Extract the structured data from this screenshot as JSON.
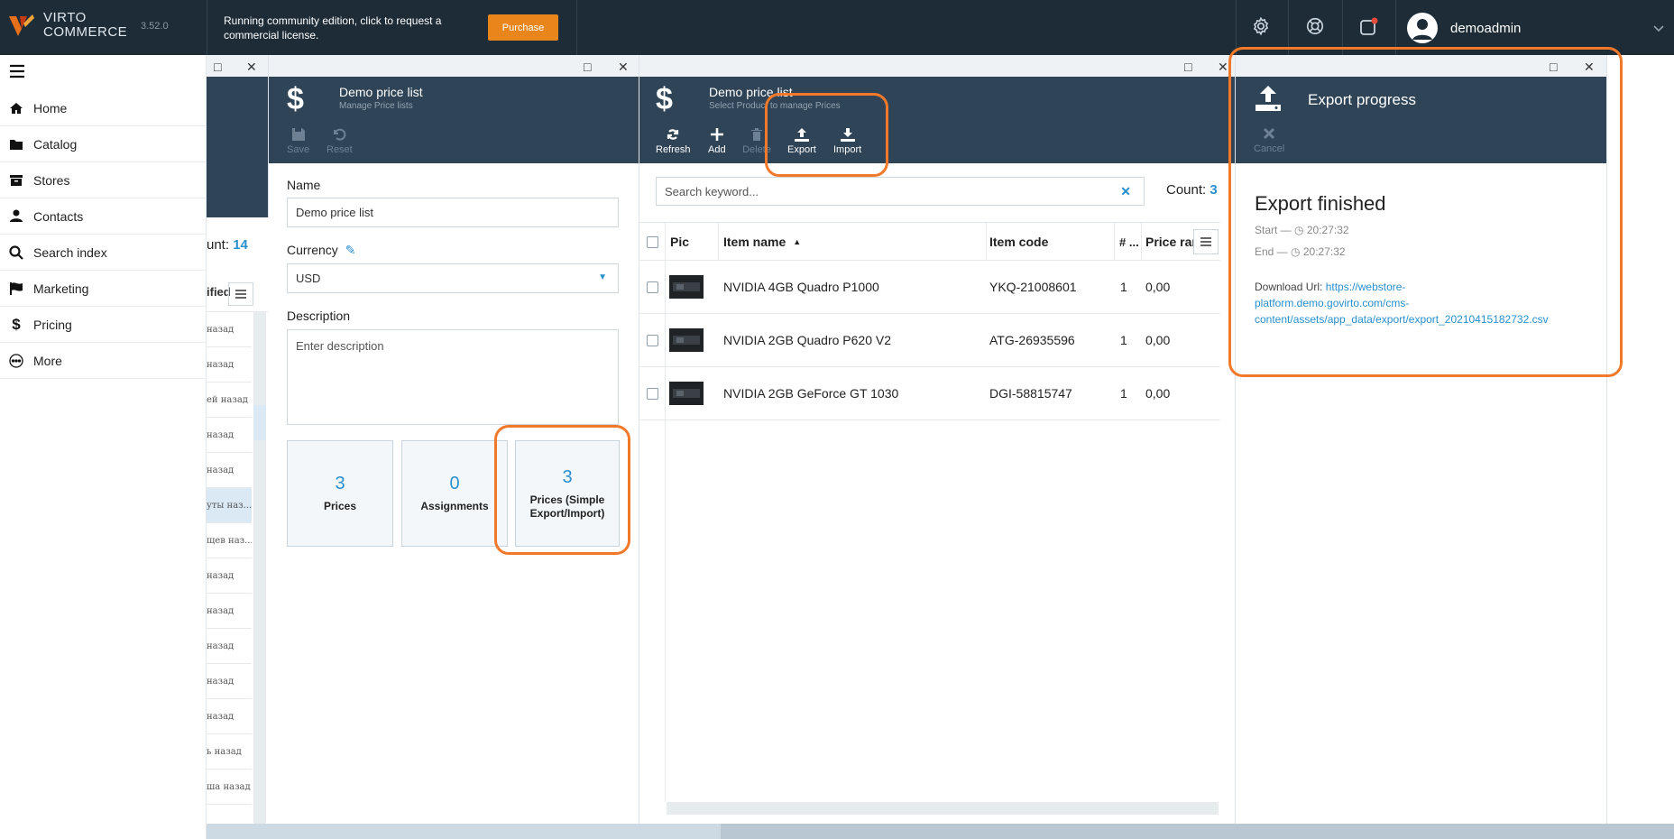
{
  "app": {
    "logo_line1": "VIRTO",
    "logo_line2": "COMMERCE",
    "version": "3.52.0",
    "notice": "Running community edition, click to request a commercial license.",
    "purchase_label": "Purchase",
    "username": "demoadmin"
  },
  "sidebar": {
    "items": [
      {
        "label": "Home",
        "icon": "home-icon"
      },
      {
        "label": "Catalog",
        "icon": "folder-icon"
      },
      {
        "label": "Stores",
        "icon": "archive-icon"
      },
      {
        "label": "Contacts",
        "icon": "user-icon"
      },
      {
        "label": "Search index",
        "icon": "search-icon"
      },
      {
        "label": "Marketing",
        "icon": "flag-icon"
      },
      {
        "label": "Pricing",
        "icon": "dollar-icon"
      },
      {
        "label": "More",
        "icon": "more-icon"
      }
    ]
  },
  "list_blade": {
    "count_label": "unt:",
    "count_value": "14",
    "column_header": "ified",
    "rows": [
      "назад",
      "назад",
      "ей назад",
      "назад",
      "назад",
      "уты наз...",
      "щев наз...",
      "назад",
      "назад",
      "назад",
      "назад",
      "назад",
      "ь назад",
      "ша назад"
    ]
  },
  "pricelist_blade": {
    "title": "Demo price list",
    "subtitle": "Manage Price lists",
    "toolbar": {
      "save": "Save",
      "reset": "Reset"
    },
    "name_label": "Name",
    "name_value": "Demo price list",
    "currency_label": "Currency",
    "currency_value": "USD",
    "description_label": "Description",
    "description_placeholder": "Enter description",
    "tiles": [
      {
        "num": "3",
        "label": "Prices"
      },
      {
        "num": "0",
        "label": "Assignments"
      },
      {
        "num": "3",
        "label": "Prices (Simple Export/Import)"
      }
    ]
  },
  "prices_blade": {
    "title": "Demo price list",
    "subtitle": "Select Product to manage Prices",
    "toolbar": {
      "refresh": "Refresh",
      "add": "Add",
      "delete": "Delete",
      "export": "Export",
      "import": "Import"
    },
    "search_placeholder": "Search keyword...",
    "count_label": "Count:",
    "count_value": "3",
    "columns": {
      "pic": "Pic",
      "name": "Item name",
      "code": "Item code",
      "qty": "# ...",
      "price": "Price ran"
    },
    "rows": [
      {
        "name": "NVIDIA 4GB Quadro P1000",
        "code": "YKQ-21008601",
        "qty": "1",
        "price": "0,00"
      },
      {
        "name": "NVIDIA 2GB Quadro P620 V2",
        "code": "ATG-26935596",
        "qty": "1",
        "price": "0,00"
      },
      {
        "name": "NVIDIA 2GB GeForce GT 1030",
        "code": "DGI-58815747",
        "qty": "1",
        "price": "0,00"
      }
    ]
  },
  "export_blade": {
    "title": "Export progress",
    "cancel": "Cancel",
    "heading": "Export finished",
    "start_label": "Start —",
    "start_time": "20:27:32",
    "end_label": "End —",
    "end_time": "20:27:32",
    "download_label": "Download Url:",
    "download_url_1": "https://webstore-",
    "download_url_2": "platform.demo.govirto.com/cms-",
    "download_url_3": "content/assets/app_data/export/export_20210415182732.csv"
  },
  "colors": {
    "header_bg": "#1e2c38",
    "blade_head_bg": "#2f4456",
    "accent": "#2a8fcd",
    "highlight": "#f2792a",
    "purchase": "#e8861b"
  }
}
